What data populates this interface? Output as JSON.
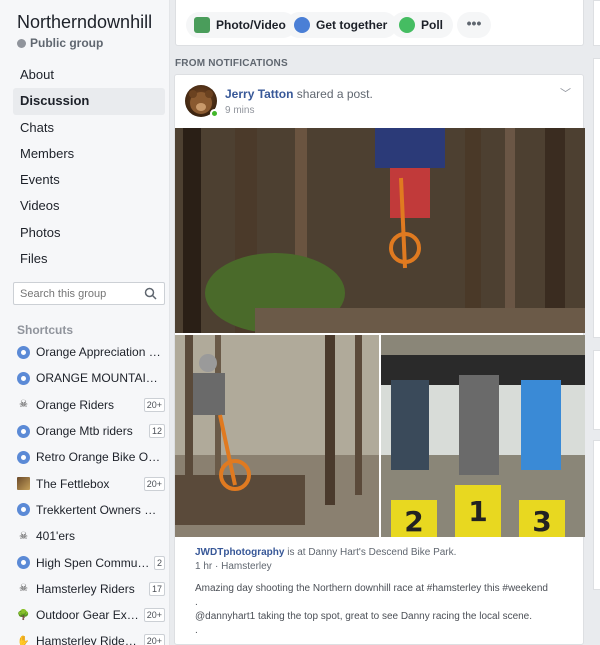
{
  "sidebar": {
    "group_name": "Northerndownhill",
    "group_type": "Public group",
    "nav": [
      {
        "label": "About"
      },
      {
        "label": "Discussion"
      },
      {
        "label": "Chats"
      },
      {
        "label": "Members"
      },
      {
        "label": "Events"
      },
      {
        "label": "Videos"
      },
      {
        "label": "Photos"
      },
      {
        "label": "Files"
      }
    ],
    "search_placeholder": "Search this group",
    "shortcuts_title": "Shortcuts",
    "shortcuts": [
      {
        "label": "Orange Appreciation So...",
        "badge": "",
        "icon": "group-icon"
      },
      {
        "label": "ORANGE MOUNTAIN ...",
        "badge": "",
        "icon": "group-icon"
      },
      {
        "label": "Orange Riders",
        "badge": "20+",
        "icon": "skull-icon"
      },
      {
        "label": "Orange Mtb riders",
        "badge": "12",
        "icon": "group-icon"
      },
      {
        "label": "Retro Orange Bike Own...",
        "badge": "",
        "icon": "group-icon"
      },
      {
        "label": "The Fettlebox",
        "badge": "20+",
        "icon": "group-thumbnail-icon"
      },
      {
        "label": "Trekkertent Owners Gro...",
        "badge": "",
        "icon": "group-icon"
      },
      {
        "label": "401'ers",
        "badge": "",
        "icon": "skull-icon"
      },
      {
        "label": "High Spen Communi...",
        "badge": "2",
        "icon": "group-icon"
      },
      {
        "label": "Hamsterley Riders",
        "badge": "17",
        "icon": "skull-icon"
      },
      {
        "label": "Outdoor Gear Exch...",
        "badge": "20+",
        "icon": "tree-icon"
      },
      {
        "label": "Hamsterley Riders:...",
        "badge": "20+",
        "icon": "hand-icon"
      }
    ]
  },
  "composer": {
    "photo_video": "Photo/Video",
    "get_together": "Get together",
    "poll": "Poll",
    "more": "•••"
  },
  "feed": {
    "section_label": "FROM NOTIFICATIONS",
    "post": {
      "author": "Jerry Tatton",
      "action": " shared a post.",
      "time": "9 mins",
      "shared_from": "JWDTphotography",
      "shared_context": " is at Danny Hart's Descend Bike Park.",
      "meta": "1 hr · Hamsterley",
      "lines": [
        "Amazing day shooting the Northern downhill race at #hamsterley this #weekend",
        ".",
        "@dannyhart1 taking the top spot, great to see Danny racing the local scene.",
        ".",
        "...."
      ]
    }
  }
}
